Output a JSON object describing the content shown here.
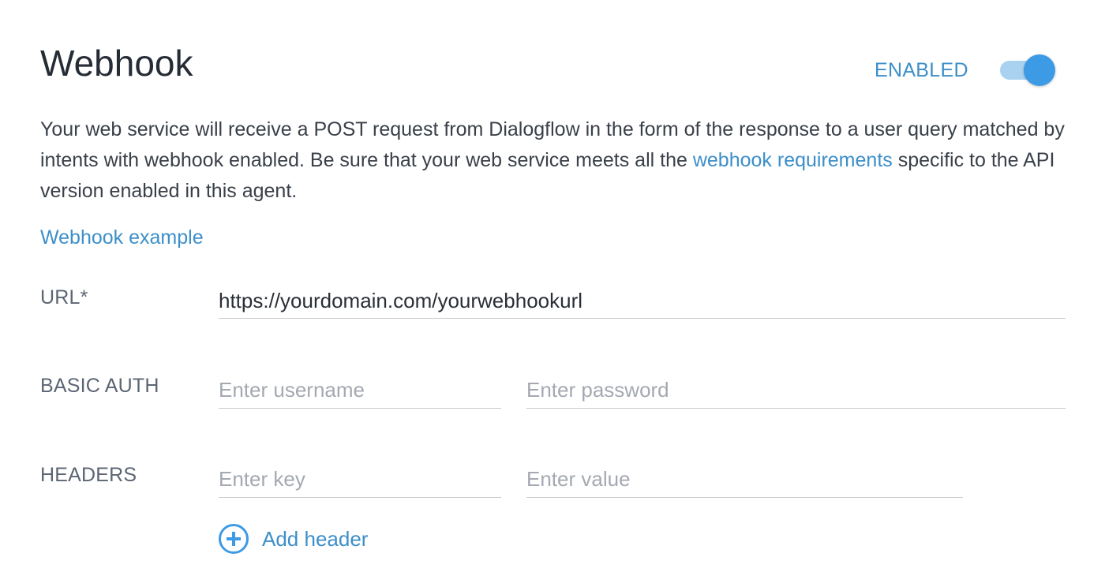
{
  "header": {
    "title": "Webhook",
    "toggle_label": "ENABLED",
    "toggle_state": "on"
  },
  "description": {
    "text_before": "Your web service will receive a POST request from Dialogflow in the form of the response to a user query matched by intents with webhook enabled. Be sure that your web service meets all the ",
    "link_text": "webhook requirements",
    "text_after": " specific to the API version enabled in this agent."
  },
  "example_link": "Webhook example",
  "url": {
    "label": "URL*",
    "value": "https://yourdomain.com/yourwebhookurl"
  },
  "basic_auth": {
    "label": "BASIC AUTH",
    "username_placeholder": "Enter username",
    "password_placeholder": "Enter password"
  },
  "headers": {
    "label": "HEADERS",
    "key_placeholder": "Enter key",
    "value_placeholder": "Enter value",
    "add_label": "Add header"
  },
  "colors": {
    "accent": "#3d9ae4",
    "link": "#3c8fc9",
    "title": "#262c35"
  },
  "icons": {
    "add_header": "plus-circle-icon"
  }
}
